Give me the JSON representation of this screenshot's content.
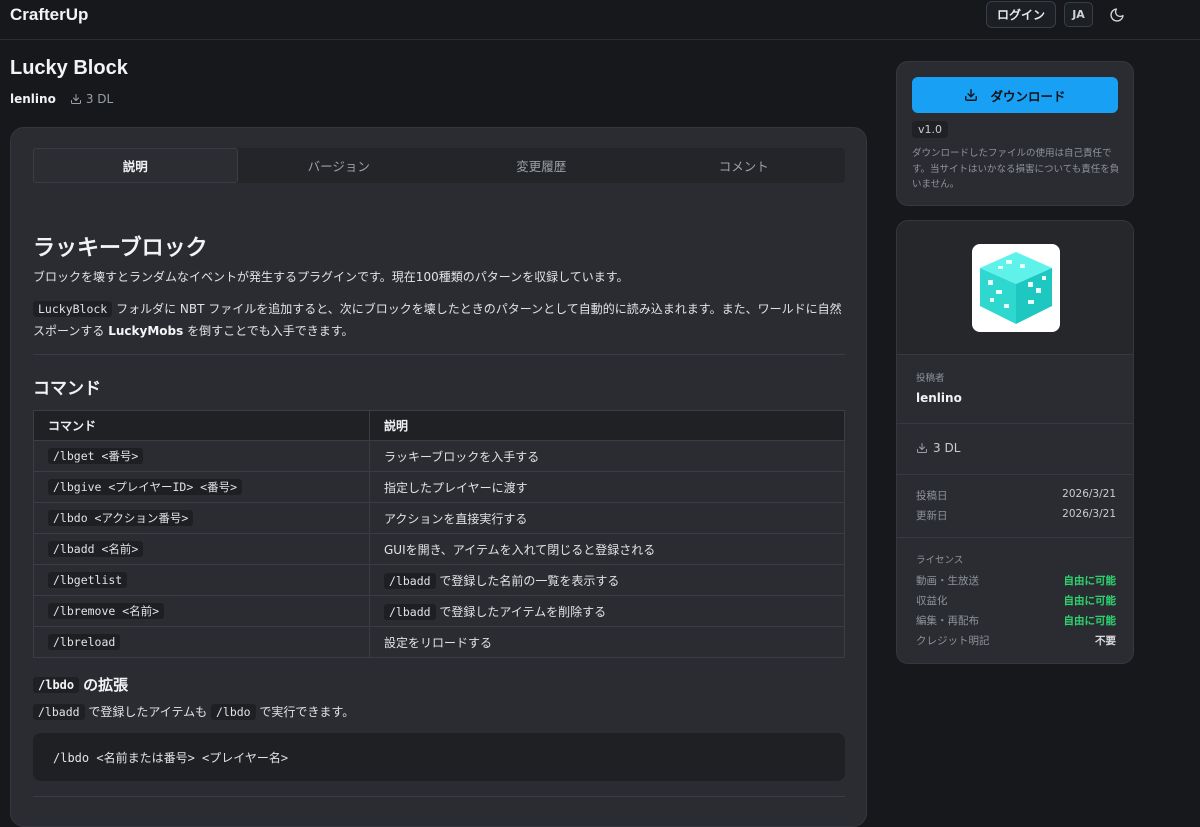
{
  "header": {
    "logo": "CrafterUp",
    "login_label": "ログイン",
    "lang_label": "JA",
    "theme_icon": "moon-icon"
  },
  "project": {
    "title": "Lucky Block",
    "author": "lenlino",
    "downloads": "3 DL"
  },
  "tabs": [
    {
      "label": "説明",
      "active": true
    },
    {
      "label": "バージョン",
      "active": false
    },
    {
      "label": "変更履歴",
      "active": false
    },
    {
      "label": "コメント",
      "active": false
    }
  ],
  "content": {
    "heading": "ラッキーブロック",
    "intro": "ブロックを壊すとランダムなイベントが発生するプラグインです。現在100種類のパターンを収録しています。",
    "para2": {
      "code1": "LuckyBlock",
      "text1": " フォルダに NBT ファイルを追加すると、次にブロックを壊したときのパターンとして自動的に読み込まれます。また、ワールドに自然スポーンする ",
      "bold1": "LuckyMobs",
      "text2": " を倒すことでも入手できます。"
    },
    "commands_heading": "コマンド",
    "table": {
      "headers": [
        "コマンド",
        "説明"
      ],
      "rows": [
        {
          "cmd": "/lbget <番号>",
          "desc_pre": "",
          "desc": "ラッキーブロックを入手する"
        },
        {
          "cmd": "/lbgive <プレイヤーID> <番号>",
          "desc_pre": "",
          "desc": "指定したプレイヤーに渡す"
        },
        {
          "cmd": "/lbdo <アクション番号>",
          "desc_pre": "",
          "desc": "アクションを直接実行する"
        },
        {
          "cmd": "/lbadd <名前>",
          "desc_pre": "",
          "desc": "GUIを開き、アイテムを入れて閉じると登録される"
        },
        {
          "cmd": "/lbgetlist",
          "desc_pre": "/lbadd",
          "desc": " で登録した名前の一覧を表示する"
        },
        {
          "cmd": "/lbremove <名前>",
          "desc_pre": "/lbadd",
          "desc": " で登録したアイテムを削除する"
        },
        {
          "cmd": "/lbreload",
          "desc_pre": "",
          "desc": "設定をリロードする"
        }
      ]
    },
    "ext_heading_code": "/lbdo",
    "ext_heading_text": "の拡張",
    "ext_para": {
      "code1": "/lbadd",
      "text1": " で登録したアイテムも ",
      "code2": "/lbdo",
      "text2": " で実行できます。"
    },
    "codeblock": "/lbdo <名前または番号> <プレイヤー名>"
  },
  "sidebar": {
    "download_label": "ダウンロード",
    "version": "v1.0",
    "note": "ダウンロードしたファイルの使用は自己責任です。当サイトはいかなる損害についても責任を負いません。",
    "author_label": "投稿者",
    "author": "lenlino",
    "downloads": "3 DL",
    "posted_label": "投稿日",
    "posted": "2026/3/21",
    "updated_label": "更新日",
    "updated": "2026/3/21",
    "license_label": "ライセンス",
    "license": [
      {
        "label": "動画・生放送",
        "value": "自由に可能"
      },
      {
        "label": "収益化",
        "value": "自由に可能"
      },
      {
        "label": "編集・再配布",
        "value": "自由に可能"
      },
      {
        "label": "クレジット明記",
        "value": "不要"
      }
    ]
  },
  "colors": {
    "accent": "#18a0f5",
    "ok": "#2dd36f",
    "background": "#16181c",
    "card": "#2a2c31"
  }
}
